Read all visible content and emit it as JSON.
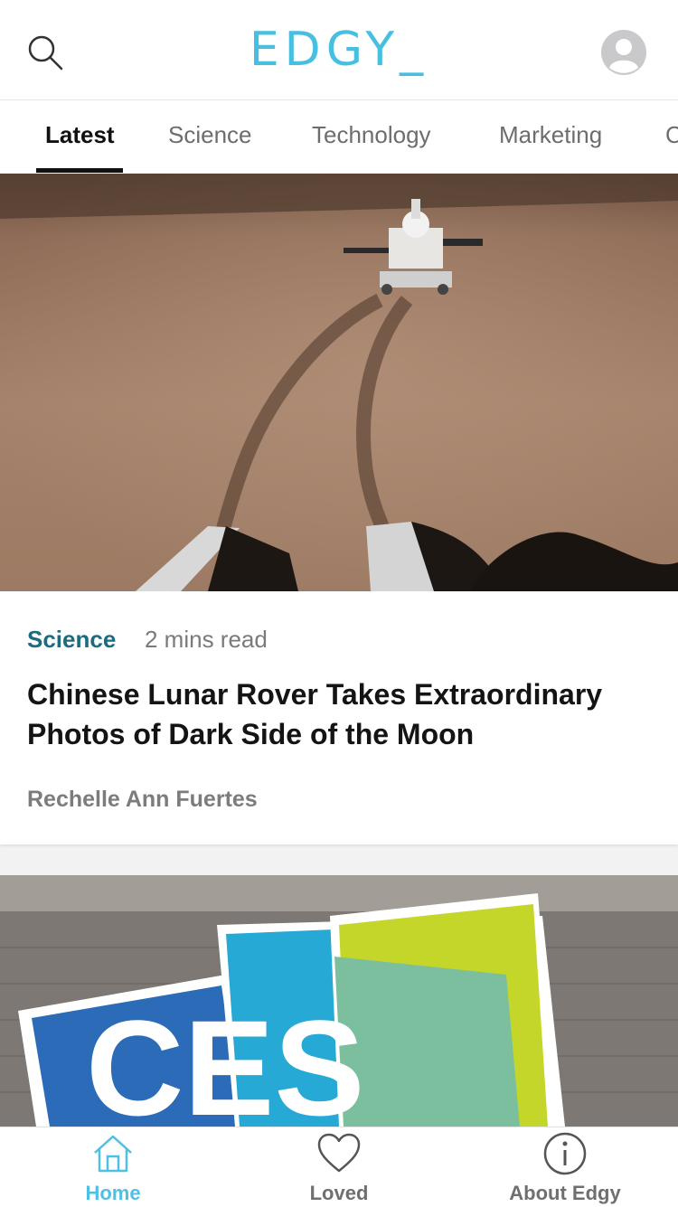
{
  "header": {
    "logo_text": "EDGY_",
    "search_icon": "search-icon",
    "avatar_icon": "user-avatar-icon"
  },
  "tabs": [
    {
      "label": "Latest",
      "active": true
    },
    {
      "label": "Science",
      "active": false
    },
    {
      "label": "Technology",
      "active": false
    },
    {
      "label": "Marketing",
      "active": false
    },
    {
      "label": "C",
      "active": false
    }
  ],
  "articles": [
    {
      "category": "Science",
      "read_time": "2 mins read",
      "title": "Chinese Lunar Rover Takes Extraordinary Photos of Dark Side of the Moon",
      "author": "Rechelle Ann Fuertes"
    }
  ],
  "ces_logo_text": "CES",
  "bottom_nav": [
    {
      "label": "Home",
      "icon": "home-icon",
      "active": true
    },
    {
      "label": "Loved",
      "icon": "heart-icon",
      "active": false
    },
    {
      "label": "About Edgy",
      "icon": "info-icon",
      "active": false
    }
  ],
  "colors": {
    "accent": "#46bfe0",
    "category": "#1d6b80",
    "active_tab": "#111111"
  }
}
